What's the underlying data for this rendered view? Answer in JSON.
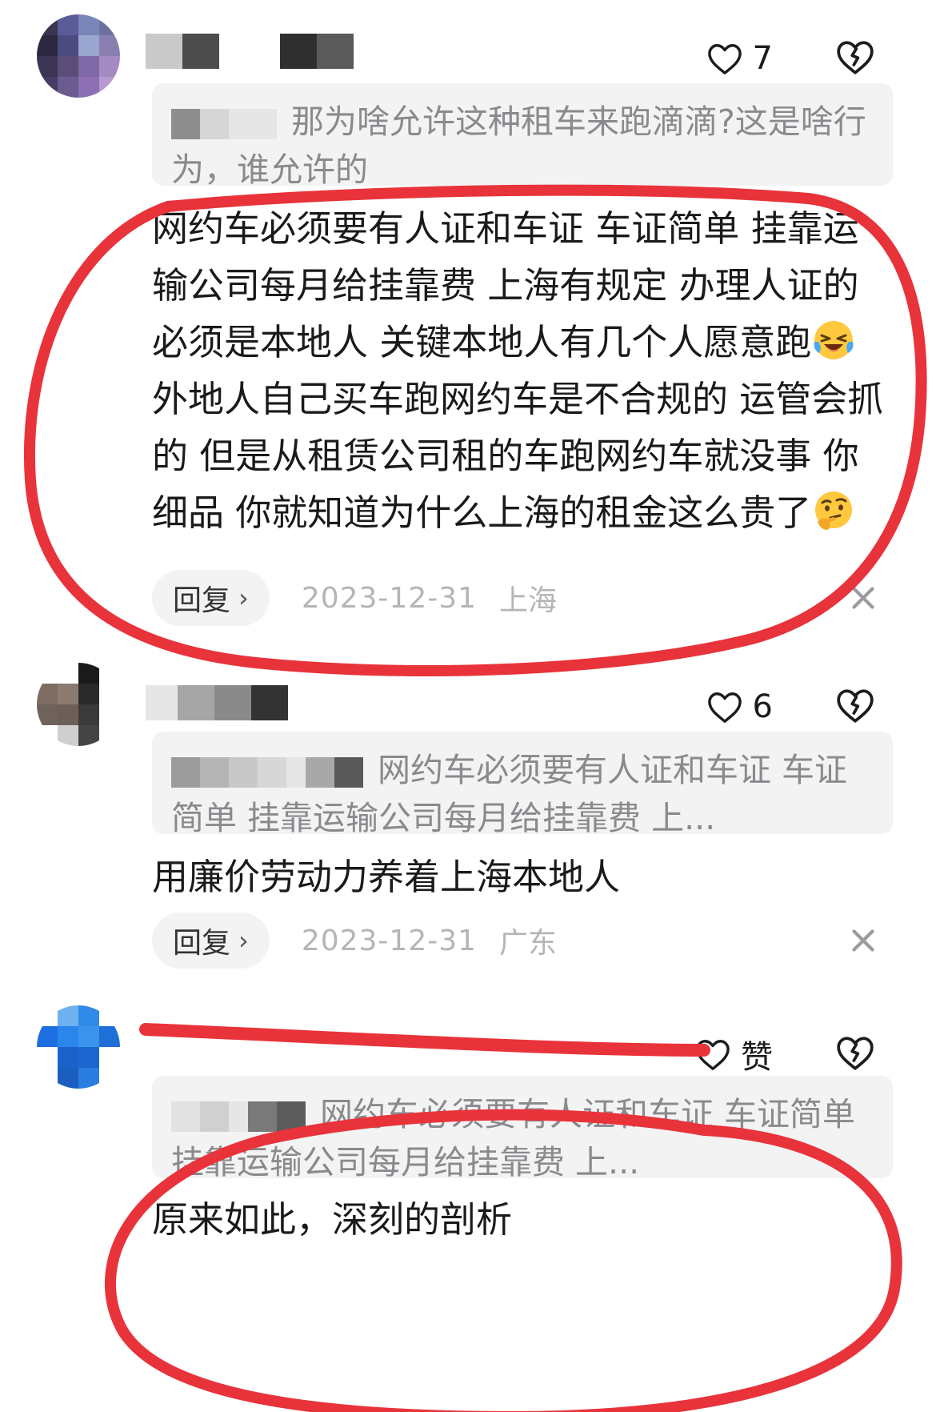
{
  "comments": [
    {
      "like_count": "7",
      "quote_text": "那为啥允许这种租车来跑滴滴?这是啥行为，谁允许的",
      "body_text_1": "网约车必须要有人证和车证 车证简单 挂靠运输公司每月给挂靠费 上海有规定 办理人证的必须是本地人 关键本地人有几个人愿意跑",
      "body_text_2": "外地人自己买车跑网约车是不合规的 运管会抓的 但是从租赁公司租的车跑网约车就没事 你细品 你就知道为什么上海的租金这么贵了",
      "date": "2023-12-31",
      "location": "上海",
      "reply_label": "回复"
    },
    {
      "like_count": "6",
      "quote_text": "网约车必须要有人证和车证 车证简单 挂靠运输公司每月给挂靠费 上...",
      "body_text": "用廉价劳动力养着上海本地人",
      "date": "2023-12-31",
      "location": "广东",
      "reply_label": "回复"
    },
    {
      "like_count": "赞",
      "quote_text": "网约车必须要有人证和车证 车证简单 挂靠运输公司每月给挂靠费 上...",
      "body_text": "原来如此，深刻的剖析"
    }
  ],
  "colors": {
    "annotation_red": "#e8333b",
    "quote_bg": "#f3f3f4",
    "secondary_text": "#8a8a8e"
  },
  "icons": {
    "like": "heart-icon",
    "dislike": "broken-heart-icon",
    "close": "close-icon",
    "emoji_1": "laughing-crying-emoji-icon",
    "emoji_2": "thinking-emoji-icon"
  }
}
